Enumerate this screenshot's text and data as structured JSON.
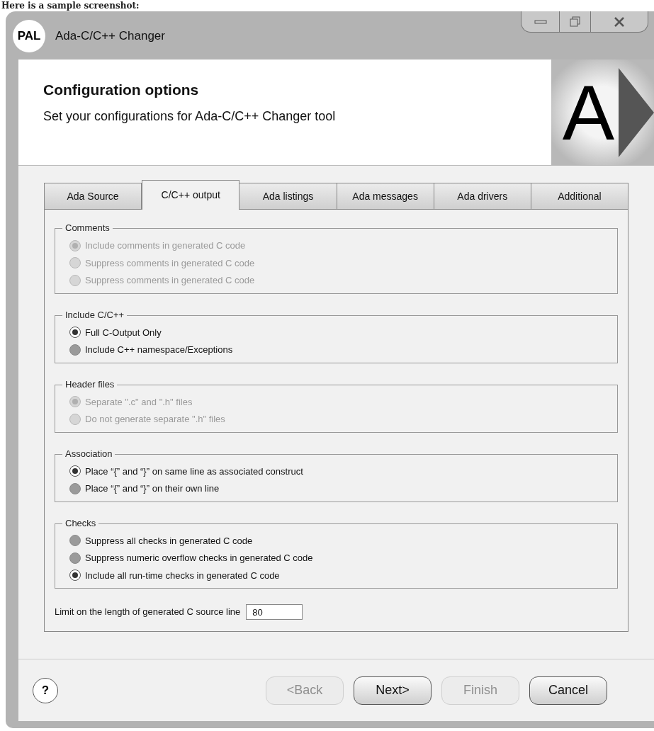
{
  "caption": "Here is a sample screenshot:",
  "window": {
    "badge": "PAL",
    "title": "Ada-C/C++ Changer"
  },
  "header": {
    "title": "Configuration options",
    "subtitle": "Set your configurations for Ada-C/C++ Changer tool",
    "logo_letter": "A"
  },
  "tabs": [
    {
      "label": "Ada Source",
      "selected": false
    },
    {
      "label": "C/C++ output",
      "selected": true
    },
    {
      "label": "Ada listings",
      "selected": false
    },
    {
      "label": "Ada messages",
      "selected": false
    },
    {
      "label": "Ada drivers",
      "selected": false
    },
    {
      "label": "Additional",
      "selected": false
    }
  ],
  "groups": [
    {
      "title": "Comments",
      "disabled": true,
      "options": [
        {
          "label": "Include comments in generated C code",
          "selected": true
        },
        {
          "label": "Suppress comments in generated C code",
          "selected": false
        },
        {
          "label": "Suppress comments in generated C code",
          "selected": false
        }
      ]
    },
    {
      "title": "Include C/C++",
      "disabled": false,
      "options": [
        {
          "label": "Full C-Output Only",
          "selected": true
        },
        {
          "label": "Include C++ namespace/Exceptions",
          "selected": false
        }
      ]
    },
    {
      "title": "Header files",
      "disabled": true,
      "options": [
        {
          "label": "Separate \".c\" and \".h\" files",
          "selected": true
        },
        {
          "label": "Do not generate separate \".h\" files",
          "selected": false
        }
      ]
    },
    {
      "title": "Association",
      "disabled": false,
      "options": [
        {
          "label": "Place “{” and “}” on same line as associated construct",
          "selected": true
        },
        {
          "label": "Place “{” and “}” on their own line",
          "selected": false
        }
      ]
    },
    {
      "title": "Checks",
      "disabled": false,
      "options": [
        {
          "label": "Suppress all checks in generated C code",
          "selected": false
        },
        {
          "label": "Suppress numeric overflow checks in generated C code",
          "selected": false
        },
        {
          "label": "Include all run-time checks in generated C code",
          "selected": true
        }
      ]
    }
  ],
  "line_limit": {
    "label": "Limit on the length of generated C source line",
    "value": "80"
  },
  "help": "?",
  "buttons": [
    {
      "label": "<Back",
      "disabled": true
    },
    {
      "label": "Next>",
      "disabled": false
    },
    {
      "label": "Finish",
      "disabled": true
    },
    {
      "label": "Cancel",
      "disabled": false
    }
  ]
}
